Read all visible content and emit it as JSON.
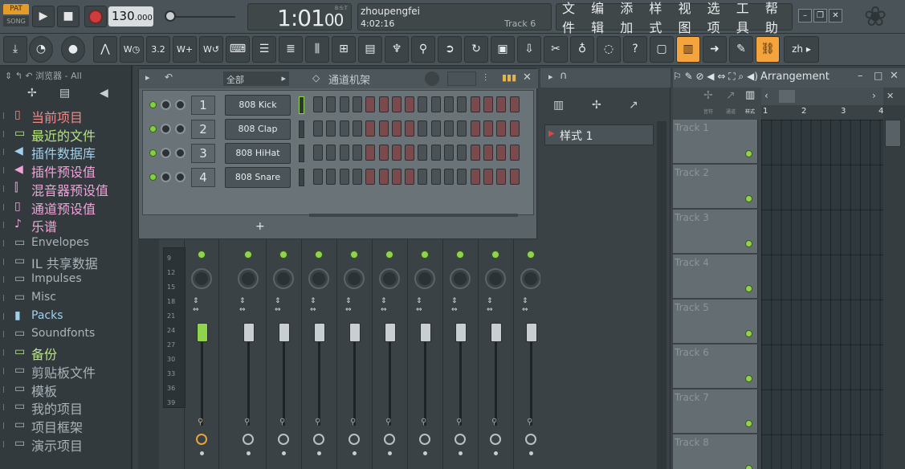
{
  "transport": {
    "pat": "PAT",
    "song": "SONG",
    "tempo_main": "130",
    "tempo_dec": ".000",
    "time": "1:01",
    "time_sub": "00",
    "bst": "B:S:T"
  },
  "hint": {
    "user": "zhoupengfei",
    "time": "4:02:16",
    "track": "Track 6"
  },
  "menu": [
    "文件",
    "编辑",
    "添加",
    "样式",
    "视图",
    "选项",
    "工具",
    "帮助"
  ],
  "toolbar": {
    "lang": "zh"
  },
  "browser": {
    "header": "浏览器 - All",
    "items": [
      {
        "icon": "▯",
        "label": "当前项目",
        "color": "#f08a8a",
        "small": false
      },
      {
        "icon": "▭",
        "label": "最近的文件",
        "color": "#b9e38a",
        "small": false
      },
      {
        "icon": "◀",
        "label": "插件数据库",
        "color": "#9fd0ec",
        "small": false
      },
      {
        "icon": "◀",
        "label": "插件预设值",
        "color": "#f0a3d9",
        "small": false
      },
      {
        "icon": "⫿",
        "label": "混音器预设值",
        "color": "#f0a3d9",
        "small": false
      },
      {
        "icon": "▯",
        "label": "通道预设值",
        "color": "#f0a3d9",
        "small": false
      },
      {
        "icon": "♪",
        "label": "乐谱",
        "color": "#f0a3d9",
        "small": false
      },
      {
        "icon": "▭",
        "label": "Envelopes",
        "color": "#aab4b8",
        "small": true
      },
      {
        "icon": "▭",
        "label": "IL 共享数据",
        "color": "#aab4b8",
        "small": false
      },
      {
        "icon": "▭",
        "label": "Impulses",
        "color": "#aab4b8",
        "small": true
      },
      {
        "icon": "▭",
        "label": "Misc",
        "color": "#aab4b8",
        "small": true
      },
      {
        "icon": "▮",
        "label": "Packs",
        "color": "#9fd0ec",
        "small": true
      },
      {
        "icon": "▭",
        "label": "Soundfonts",
        "color": "#aab4b8",
        "small": true
      },
      {
        "icon": "▭",
        "label": "备份",
        "color": "#b9e38a",
        "small": false
      },
      {
        "icon": "▭",
        "label": "剪贴板文件",
        "color": "#aab4b8",
        "small": false
      },
      {
        "icon": "▭",
        "label": "模板",
        "color": "#aab4b8",
        "small": false
      },
      {
        "icon": "▭",
        "label": "我的项目",
        "color": "#aab4b8",
        "small": false
      },
      {
        "icon": "▭",
        "label": "项目框架",
        "color": "#aab4b8",
        "small": false
      },
      {
        "icon": "▭",
        "label": "演示项目",
        "color": "#aab4b8",
        "small": false
      }
    ]
  },
  "rack": {
    "filter": "全部",
    "title": "通道机架",
    "add": "+",
    "channels": [
      {
        "num": "1",
        "name": "808 Kick",
        "steps": [
          0,
          0,
          0,
          0,
          1,
          1,
          1,
          1,
          0,
          0,
          0,
          0,
          1,
          1,
          1,
          1
        ]
      },
      {
        "num": "2",
        "name": "808 Clap",
        "steps": [
          0,
          0,
          0,
          0,
          1,
          1,
          1,
          1,
          0,
          0,
          0,
          0,
          1,
          1,
          1,
          1
        ]
      },
      {
        "num": "3",
        "name": "808 HiHat",
        "steps": [
          0,
          0,
          0,
          0,
          1,
          1,
          1,
          1,
          0,
          0,
          0,
          0,
          1,
          1,
          1,
          1
        ]
      },
      {
        "num": "4",
        "name": "808 Snare",
        "steps": [
          0,
          0,
          0,
          0,
          1,
          1,
          1,
          1,
          0,
          0,
          0,
          0,
          1,
          1,
          1,
          1
        ]
      }
    ]
  },
  "mixer": {
    "meter_labels": [
      "9",
      "12",
      "15",
      "18",
      "21",
      "24",
      "27",
      "30",
      "33",
      "36",
      "39"
    ]
  },
  "picker": {
    "pattern": "样式 1"
  },
  "playlist": {
    "title": "Arrangement",
    "tabs": [
      "音符",
      "通道",
      "样式"
    ],
    "ruler": [
      "1",
      "2",
      "3",
      "4"
    ],
    "tracks": [
      "Track 1",
      "Track 2",
      "Track 3",
      "Track 4",
      "Track 5",
      "Track 6",
      "Track 7",
      "Track 8"
    ]
  }
}
